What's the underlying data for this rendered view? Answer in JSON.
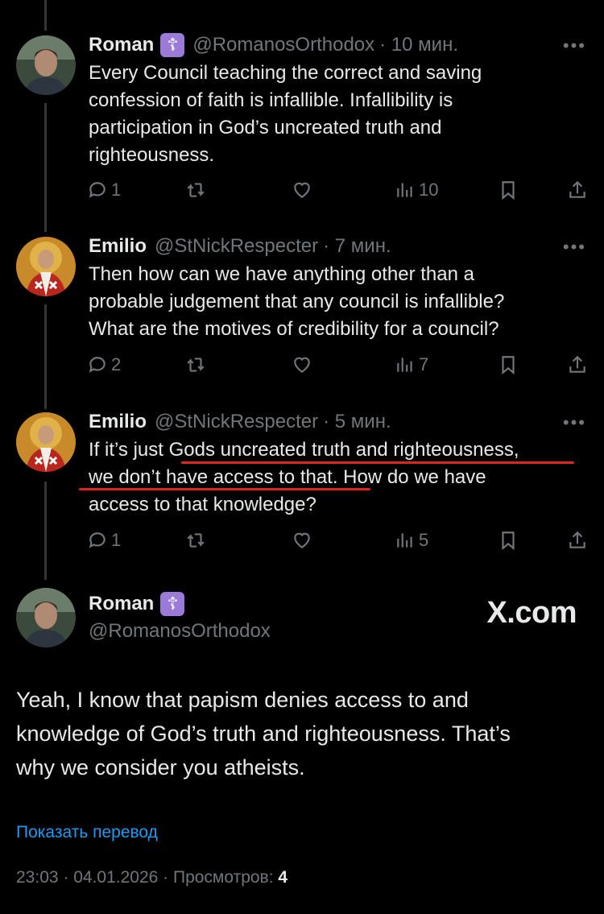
{
  "tweets": [
    {
      "name": "Roman",
      "badge": "☦",
      "handle": "@RomanosOrthodox",
      "time": "· 10 мин.",
      "lines": [
        "Every Council teaching the correct and saving",
        "confession of faith is infallible. Infallibility is",
        "participation in God’s uncreated truth and",
        "righteousness."
      ],
      "replies": "1",
      "retweets": "",
      "likes": "",
      "views": "10"
    },
    {
      "name": "Emilio",
      "handle": "@StNickRespecter",
      "time": "· 7 мин.",
      "lines": [
        "Then how can we have anything other than a",
        "probable judgement that any council is infallible?",
        "What are the motives of credibility for a council?"
      ],
      "replies": "2",
      "retweets": "",
      "likes": "",
      "views": "7"
    },
    {
      "name": "Emilio",
      "handle": "@StNickRespecter",
      "time": "· 5 мин.",
      "lines": [
        "If it’s just Gods uncreated truth and righteousness,",
        "we don’t have access to that. How do we have",
        "access to that knowledge?"
      ],
      "replies": "1",
      "retweets": "",
      "likes": "",
      "views": "5"
    }
  ],
  "main_tweet": {
    "name": "Roman",
    "badge": "☦",
    "handle": "@RomanosOrthodox",
    "lines": [
      "Yeah, I know that papism denies access to and",
      "knowledge of God’s truth and righteousness. That’s",
      "why we consider you atheists."
    ],
    "translate_label": "Показать перевод",
    "timestamp": "23:03 · 04.01.2026 · Просмотров:",
    "views": "4"
  },
  "watermark": "X.com",
  "more_label": "•••",
  "colors": {
    "background": "#000000",
    "text": "#e7e9ea",
    "muted": "#71767b",
    "link": "#1d9bf0",
    "underline": "#e0231e",
    "badge": "#9b7ad8"
  },
  "icons": [
    "reply-icon",
    "retweet-icon",
    "like-icon",
    "views-icon",
    "bookmark-icon",
    "share-icon",
    "more-icon"
  ]
}
